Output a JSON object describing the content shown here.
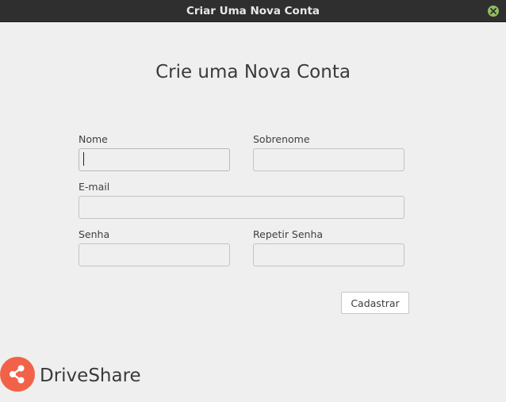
{
  "window": {
    "title": "Criar Uma Nova Conta",
    "close_icon": "close-icon"
  },
  "form": {
    "heading": "Crie uma Nova Conta",
    "fields": {
      "first_name": {
        "label": "Nome",
        "value": "",
        "placeholder": ""
      },
      "last_name": {
        "label": "Sobrenome",
        "value": "",
        "placeholder": ""
      },
      "email": {
        "label": "E-mail",
        "value": "",
        "placeholder": ""
      },
      "password": {
        "label": "Senha",
        "value": "",
        "placeholder": ""
      },
      "password_repeat": {
        "label": "Repetir Senha",
        "value": "",
        "placeholder": ""
      }
    },
    "submit_label": "Cadastrar"
  },
  "brand": {
    "name": "DriveShare",
    "logo_icon": "share-icon",
    "logo_color": "#f16248"
  },
  "colors": {
    "titlebar": "#2f2f2f",
    "background": "#efefef",
    "close_button": "#8fbf5d"
  }
}
